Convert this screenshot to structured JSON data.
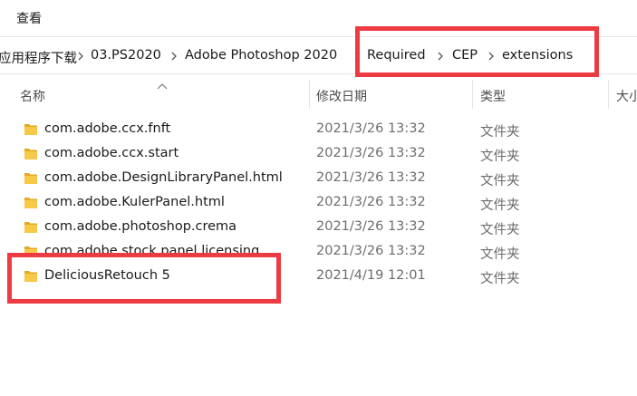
{
  "menu": {
    "view_label": "查看"
  },
  "breadcrumb": {
    "items": [
      "应用程序下载",
      "03.PS2020",
      "Adobe Photoshop 2020",
      "Required",
      "CEP",
      "extensions"
    ]
  },
  "columns": {
    "name": "名称",
    "date": "修改日期",
    "type": "类型",
    "size": "大小"
  },
  "files": [
    {
      "name": "com.adobe.ccx.fnft",
      "date": "2021/3/26 13:32",
      "type": "文件夹"
    },
    {
      "name": "com.adobe.ccx.start",
      "date": "2021/3/26 13:32",
      "type": "文件夹"
    },
    {
      "name": "com.adobe.DesignLibraryPanel.html",
      "date": "2021/3/26 13:32",
      "type": "文件夹"
    },
    {
      "name": "com.adobe.KulerPanel.html",
      "date": "2021/3/26 13:32",
      "type": "文件夹"
    },
    {
      "name": "com.adobe.photoshop.crema",
      "date": "2021/3/26 13:32",
      "type": "文件夹"
    },
    {
      "name": "com.adobe.stock.panel.licensing",
      "date": "2021/3/26 13:32",
      "type": "文件夹"
    },
    {
      "name": "DeliciousRetouch 5",
      "date": "2021/4/19 12:01",
      "type": "文件夹"
    }
  ],
  "colors": {
    "folder": "#f7c948",
    "folder_dark": "#e2aa22",
    "highlight": "#ee3b42"
  },
  "icons": {
    "folder": "folder-icon",
    "chevron": "chevron-right-icon",
    "sort": "sort-ascending-icon"
  }
}
